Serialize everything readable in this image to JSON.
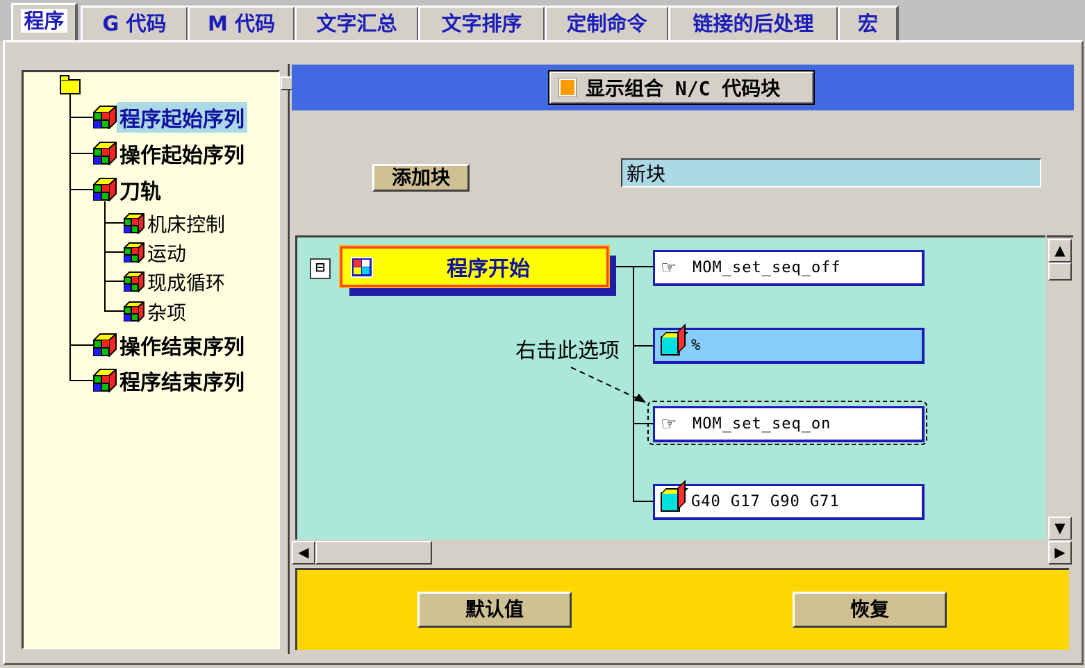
{
  "tabs": [
    {
      "label": "程序",
      "active": true
    },
    {
      "label": "G 代码"
    },
    {
      "label": "M 代码"
    },
    {
      "label": "文字汇总"
    },
    {
      "label": "文字排序"
    },
    {
      "label": "定制命令"
    },
    {
      "label": "链接的后处理"
    },
    {
      "label": "宏"
    }
  ],
  "tree": {
    "root_icon": "folder-icon",
    "items": [
      {
        "label": "程序起始序列",
        "selected": true
      },
      {
        "label": "操作起始序列"
      },
      {
        "label": "刀轨"
      },
      {
        "label": "机床控制"
      },
      {
        "label": "运动"
      },
      {
        "label": "现成循环"
      },
      {
        "label": "杂项"
      },
      {
        "label": "操作结束序列"
      },
      {
        "label": "程序结束序列"
      }
    ]
  },
  "header": {
    "toggle_label": "显示组合 N/C 代码块",
    "toggle_color": "#ff9a00"
  },
  "controls": {
    "add_block_label": "添加块",
    "block_name_value": "新块"
  },
  "sequence": {
    "collapse_symbol": "⊟",
    "root_label": "程序开始",
    "blocks": [
      {
        "label": "MOM_set_seq_off",
        "icon": "pointing-hand-icon"
      },
      {
        "label": "%",
        "icon": "cube-icon",
        "highlighted": true
      },
      {
        "label": "MOM_set_seq_on",
        "icon": "pointing-hand-icon"
      },
      {
        "label": "G40 G17 G90 G71",
        "icon": "cube-icon"
      }
    ],
    "annotation": "右击此选项"
  },
  "footer": {
    "default_label": "默认值",
    "restore_label": "恢复"
  },
  "colors": {
    "header_band": "#4169e1",
    "canvas_bg": "#ace8d8",
    "footer_bg": "#ffd700",
    "tree_bg": "#ffffe0"
  }
}
